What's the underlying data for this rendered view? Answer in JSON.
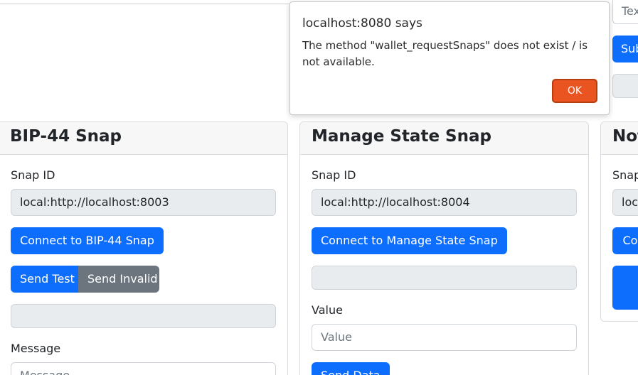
{
  "dialog": {
    "title": "localhost:8080 says",
    "message": "The method \"wallet_requestSnaps\" does not exist / is not available.",
    "ok_label": "OK"
  },
  "top_right": {
    "text_placeholder": "Tex",
    "submit_label": "Sub"
  },
  "bip44": {
    "title": "BIP-44 Snap",
    "snap_id_label": "Snap ID",
    "snap_id_value": "local:http://localhost:8003",
    "connect_label": "Connect to BIP-44 Snap",
    "send_test_label": "Send Test",
    "send_invalid_label": "Send Invalid",
    "message_label": "Message",
    "message_placeholder": "Message"
  },
  "manage_state": {
    "title": "Manage State Snap",
    "snap_id_label": "Snap ID",
    "snap_id_value": "local:http://localhost:8004",
    "connect_label": "Connect to Manage State Snap",
    "value_label": "Value",
    "value_placeholder": "Value",
    "send_data_label": "Send Data"
  },
  "third_card": {
    "title": "Not",
    "snap_id_label": "Snap",
    "snap_id_value": "loca",
    "connect_label": "Con"
  }
}
